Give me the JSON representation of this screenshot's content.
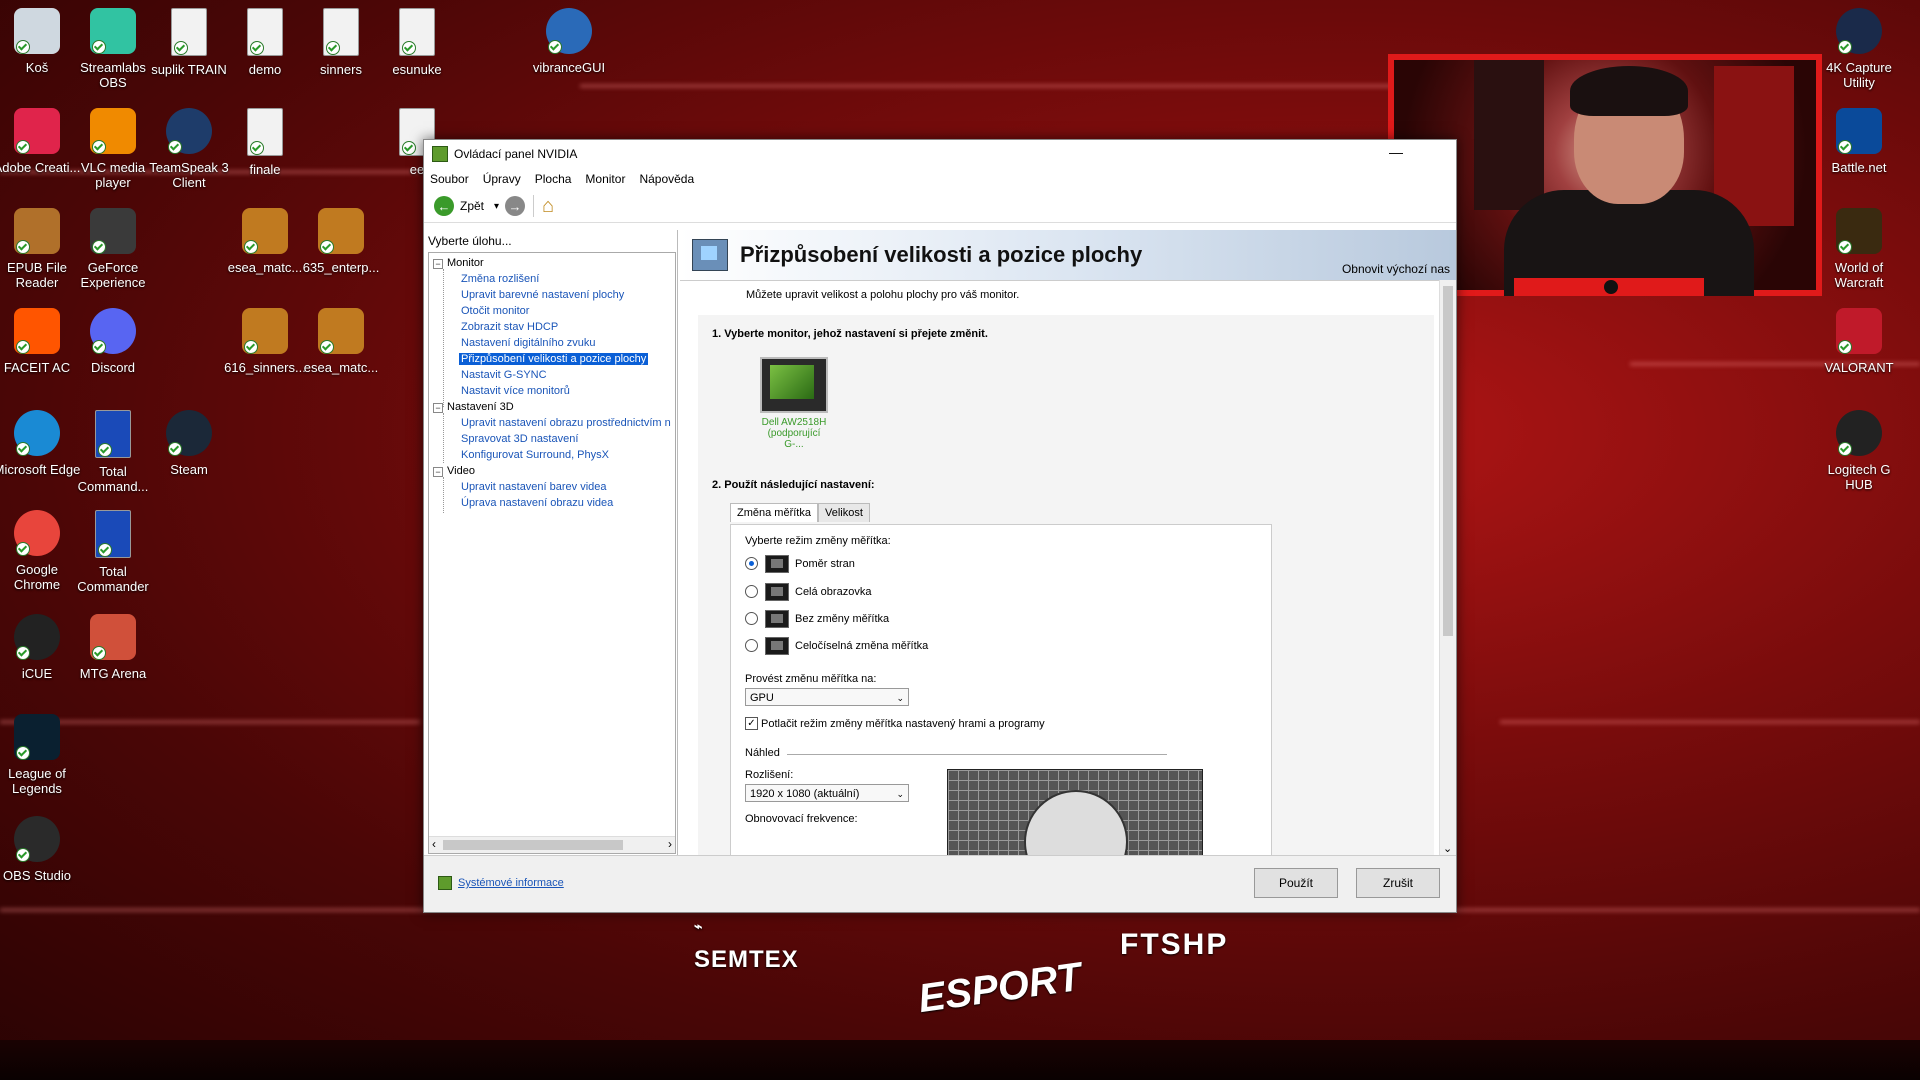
{
  "desktop": {
    "icons": [
      {
        "id": "kos",
        "label": "Koš",
        "color": "#cfd8e0"
      },
      {
        "id": "streamlabs",
        "label": "Streamlabs OBS",
        "color": "#31c3a2"
      },
      {
        "id": "suplik",
        "label": "suplik TRAIN",
        "color": "#f2f2f2"
      },
      {
        "id": "demo",
        "label": "demo",
        "color": "#f2f2f2"
      },
      {
        "id": "sinners",
        "label": "sinners",
        "color": "#f2f2f2"
      },
      {
        "id": "esunuke",
        "label": "esunuke",
        "color": "#f2f2f2"
      },
      {
        "id": "vibrance",
        "label": "vibranceGUI",
        "color": "#2a6ab8"
      },
      {
        "id": "adobe",
        "label": "Adobe Creati...",
        "color": "#e0244b"
      },
      {
        "id": "vlc",
        "label": "VLC media player",
        "color": "#f08a00"
      },
      {
        "id": "teamspeak",
        "label": "TeamSpeak 3 Client",
        "color": "#1e3c6a"
      },
      {
        "id": "finale",
        "label": "finale",
        "color": "#f2f2f2"
      },
      {
        "id": "ee",
        "label": "ee",
        "color": "#f2f2f2"
      },
      {
        "id": "epub",
        "label": "EPUB File Reader",
        "color": "#b0702a"
      },
      {
        "id": "geforce",
        "label": "GeForce Experience",
        "color": "#3a3a3a"
      },
      {
        "id": "esea1",
        "label": "esea_matc...",
        "color": "#c07a20"
      },
      {
        "id": "enterp",
        "label": "635_enterp...",
        "color": "#c07a20"
      },
      {
        "id": "faceit",
        "label": "FACEIT AC",
        "color": "#ff5500"
      },
      {
        "id": "discord",
        "label": "Discord",
        "color": "#5865f2"
      },
      {
        "id": "sinners616",
        "label": "616_sinners...",
        "color": "#c07a20"
      },
      {
        "id": "esea2",
        "label": "esea_matc...",
        "color": "#c07a20"
      },
      {
        "id": "edge",
        "label": "Microsoft Edge",
        "color": "#1a8ad4"
      },
      {
        "id": "totalcmd1",
        "label": "Total Command...",
        "color": "#1a4ab8"
      },
      {
        "id": "steam",
        "label": "Steam",
        "color": "#1b2838"
      },
      {
        "id": "chrome",
        "label": "Google Chrome",
        "color": "#e8453c"
      },
      {
        "id": "totalcmd2",
        "label": "Total Commander",
        "color": "#1a4ab8"
      },
      {
        "id": "icue",
        "label": "iCUE",
        "color": "#222222"
      },
      {
        "id": "mtg",
        "label": "MTG Arena",
        "color": "#d0503a"
      },
      {
        "id": "lol",
        "label": "League of Legends",
        "color": "#0a2030"
      },
      {
        "id": "obs",
        "label": "OBS Studio",
        "color": "#2a2a2a"
      },
      {
        "id": "4k",
        "label": "4K Capture Utility",
        "color": "#1a2a4a"
      },
      {
        "id": "battlenet",
        "label": "Battle.net",
        "color": "#0a4a9a"
      },
      {
        "id": "wow",
        "label": "World of Warcraft",
        "color": "#3a2a10"
      },
      {
        "id": "valorant",
        "label": "VALORANT",
        "color": "#c01a2a"
      },
      {
        "id": "logitech",
        "label": "Logitech G HUB",
        "color": "#222222"
      }
    ]
  },
  "window": {
    "title": "Ovládací panel NVIDIA",
    "minimize": "—",
    "menu": [
      "Soubor",
      "Úpravy",
      "Plocha",
      "Monitor",
      "Nápověda"
    ],
    "toolbar": {
      "back_label": "Zpět",
      "back_arrow": "←",
      "fwd_arrow": "→",
      "dropdown_caret": "▾",
      "home_glyph": "⌂"
    },
    "left_header": "Vyberte úlohu...",
    "tree": {
      "monitor": "Monitor",
      "monitor_items": [
        "Změna rozlišení",
        "Upravit barevné nastavení plochy",
        "Otočit monitor",
        "Zobrazit stav HDCP",
        "Nastavení digitálního zvuku",
        "Přizpůsobení velikosti a pozice plochy",
        "Nastavit G-SYNC",
        "Nastavit více monitorů"
      ],
      "nastaveni3d": "Nastavení 3D",
      "nastaveni3d_items": [
        "Upravit nastavení obrazu prostřednictvím n",
        "Spravovat 3D nastavení",
        "Konfigurovat Surround, PhysX"
      ],
      "video": "Video",
      "video_items": [
        "Upravit nastavení barev videa",
        "Úprava nastavení obrazu videa"
      ],
      "collapse_glyph": "−",
      "scroll_left": "‹",
      "scroll_right": "›"
    },
    "page": {
      "title": "Přizpůsobení velikosti a pozice plochy",
      "restore": "Obnovit výchozí nas",
      "description": "Můžete upravit velikost a polohu plochy pro váš monitor.",
      "section1": "1. Vyberte monitor, jehož nastavení si přejete změnit.",
      "monitor_name": "Dell AW2518H",
      "monitor_sub": "(podporující G-...",
      "section2": "2. Použít následující nastavení:",
      "tabs": [
        "Změna měřítka",
        "Velikost"
      ],
      "scaling_mode_label": "Vyberte režim změny měřítka:",
      "scaling_modes": [
        "Poměr stran",
        "Celá obrazovka",
        "Bez změny měřítka",
        "Celočíselná změna měřítka"
      ],
      "selected_mode": "Poměr stran",
      "perform_on_label": "Provést změnu měřítka na:",
      "perform_on_value": "GPU",
      "override_label": "Potlačit režim změny měřítka nastavený hrami a programy",
      "override_checked": "✓",
      "preview_label": "Náhled",
      "resolution_label": "Rozlišení:",
      "resolution_value": "1920 x 1080 (aktuální)",
      "refresh_label": "Obnovovací frekvence:",
      "select_caret": "⌄",
      "scroll_down": "⌄"
    },
    "footer": {
      "sysinfo": "Systémové informace",
      "apply": "Použít",
      "cancel": "Zrušit"
    }
  },
  "sponsors": {
    "semtex": "SEMTEX",
    "sazka": "ESPORT",
    "ftshp": "FTSHP"
  }
}
